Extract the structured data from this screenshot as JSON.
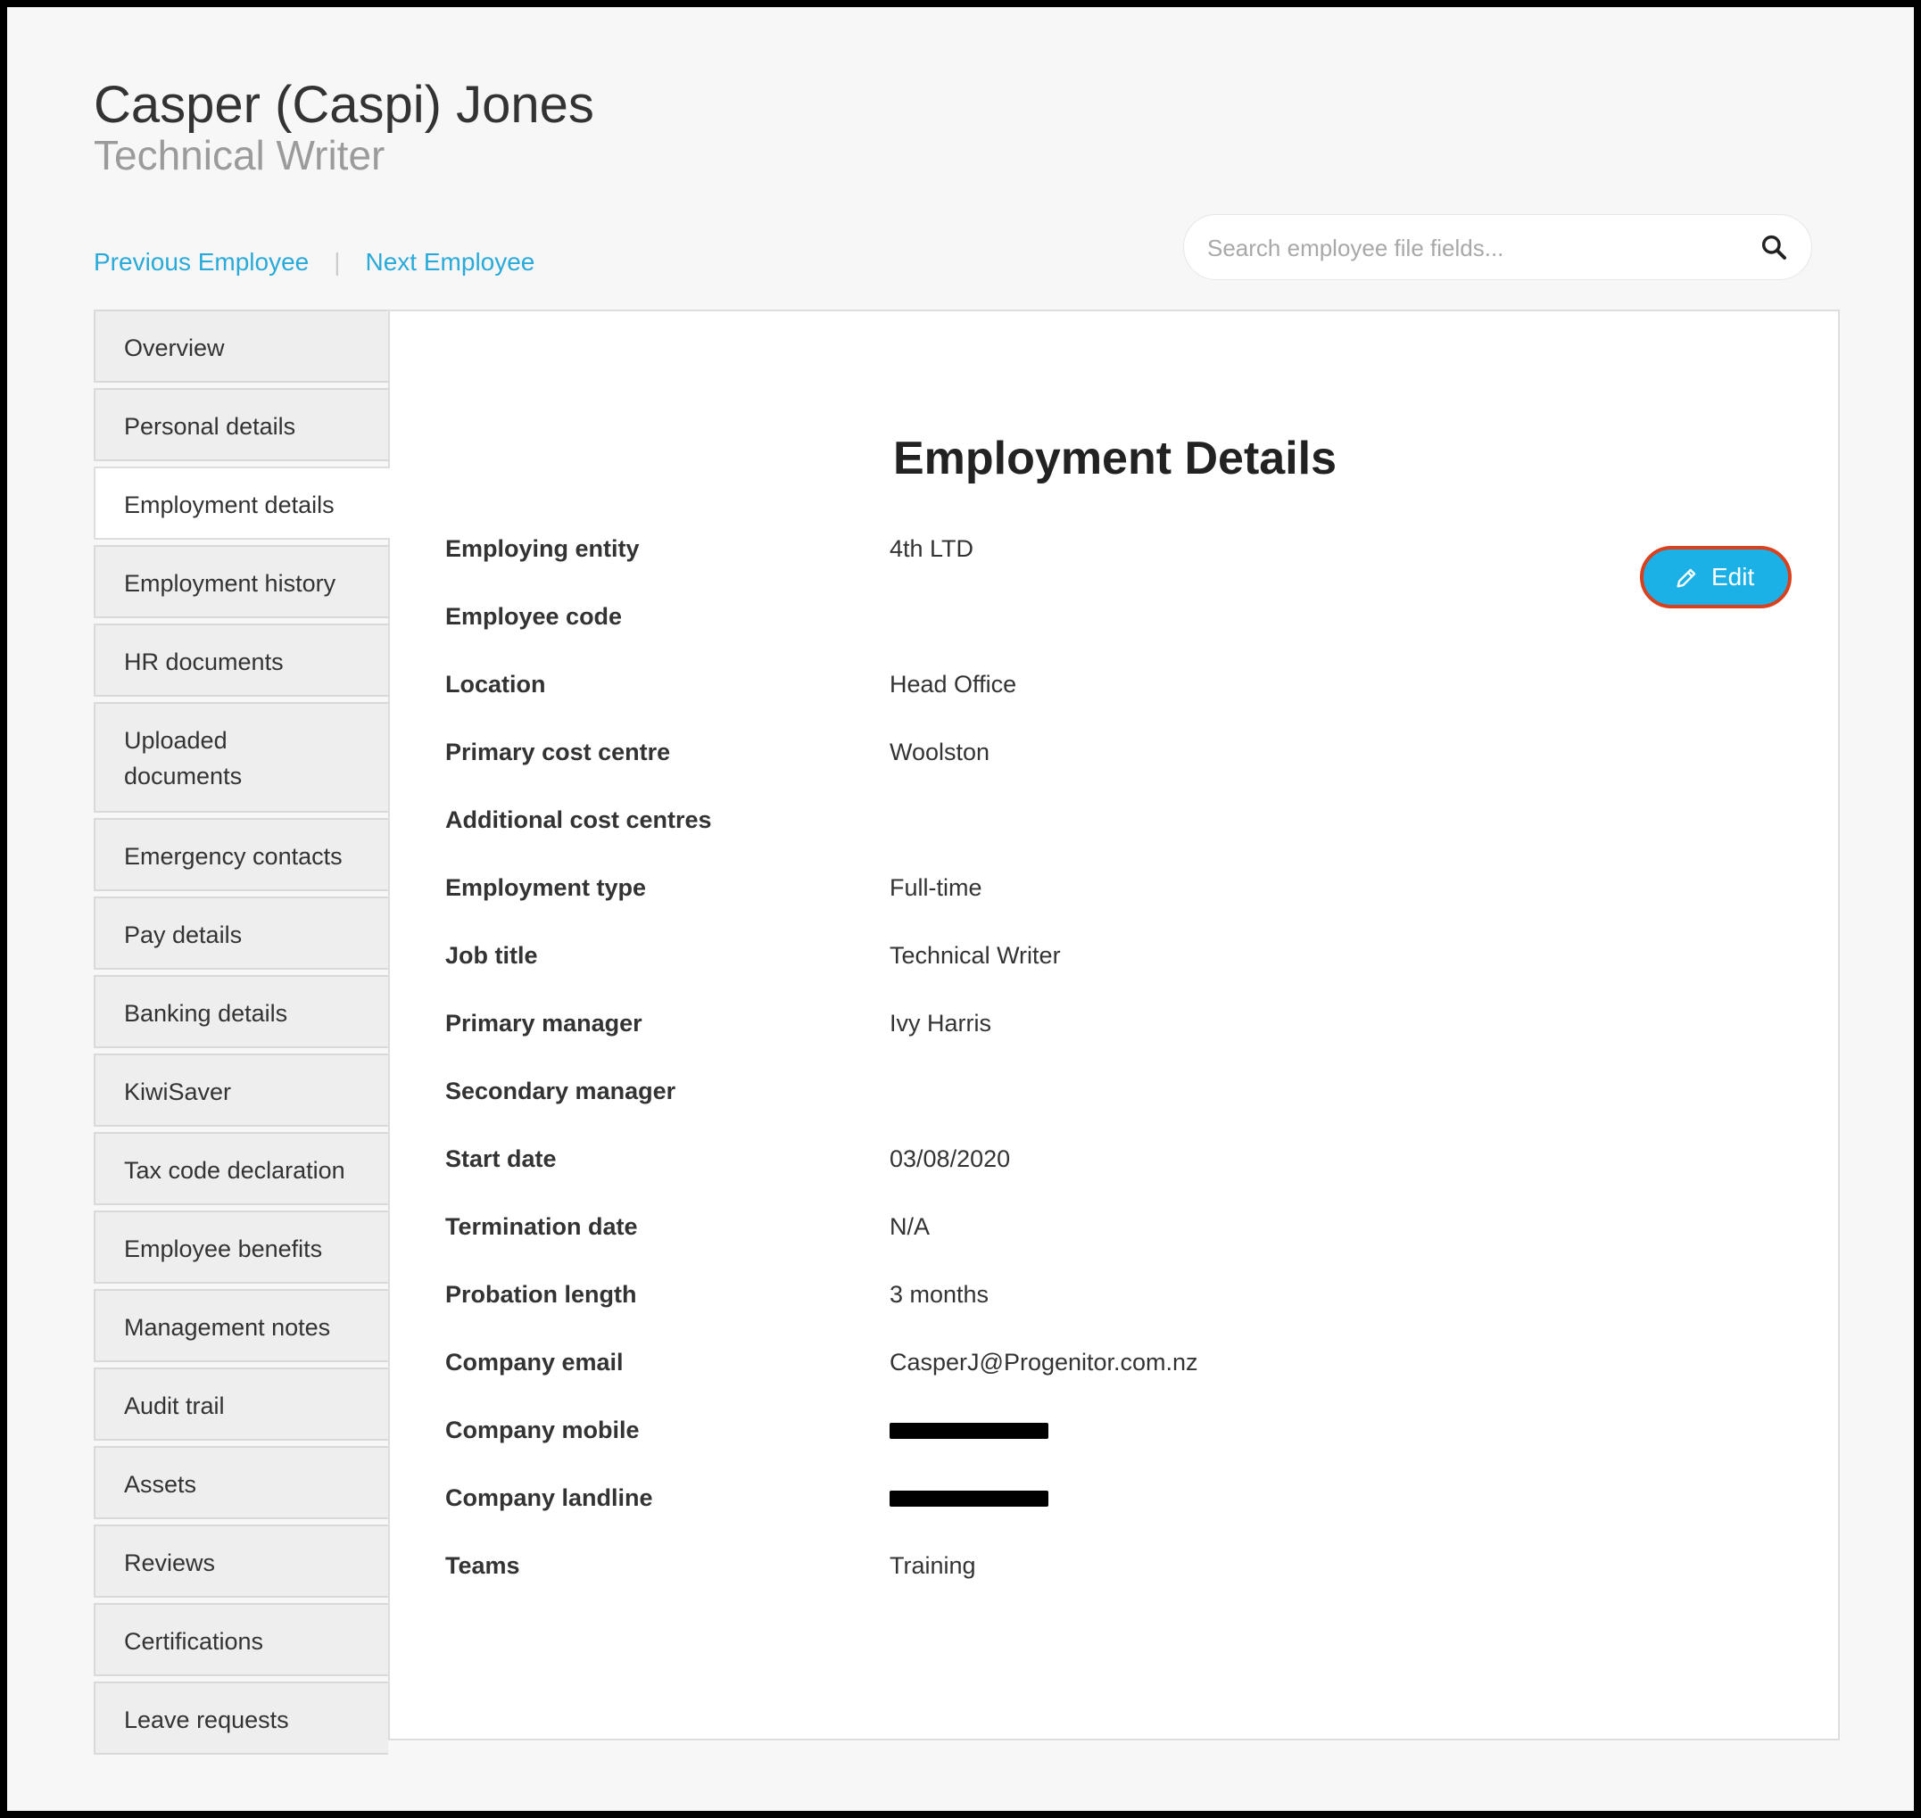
{
  "employee": {
    "name": "Casper (Caspi) Jones",
    "role": "Technical Writer"
  },
  "nav": {
    "previous": "Previous Employee",
    "separator": "|",
    "next": "Next Employee"
  },
  "search": {
    "placeholder": "Search employee file fields...",
    "value": "",
    "icon": "search-icon"
  },
  "sidebar": {
    "active": "Employment details",
    "items": [
      {
        "label": "Overview"
      },
      {
        "label": "Personal details"
      },
      {
        "label": "Employment details"
      },
      {
        "label": "Employment history"
      },
      {
        "label": "HR documents"
      },
      {
        "label": "Uploaded documents"
      },
      {
        "label": "Emergency contacts"
      },
      {
        "label": "Pay details"
      },
      {
        "label": "Banking details"
      },
      {
        "label": "KiwiSaver"
      },
      {
        "label": "Tax code declaration"
      },
      {
        "label": "Employee benefits"
      },
      {
        "label": "Management notes"
      },
      {
        "label": "Audit trail"
      },
      {
        "label": "Assets"
      },
      {
        "label": "Reviews"
      },
      {
        "label": "Certifications"
      },
      {
        "label": "Leave requests"
      }
    ]
  },
  "panel": {
    "title": "Employment Details",
    "edit_label": "Edit",
    "edit_icon": "pencil-icon",
    "fields": [
      {
        "label": "Employing entity",
        "value": "4th LTD"
      },
      {
        "label": "Employee code",
        "value": ""
      },
      {
        "label": "Location",
        "value": "Head Office"
      },
      {
        "label": "Primary cost centre",
        "value": "Woolston"
      },
      {
        "label": "Additional cost centres",
        "value": ""
      },
      {
        "label": "Employment type",
        "value": "Full-time"
      },
      {
        "label": "Job title",
        "value": "Technical Writer"
      },
      {
        "label": "Primary manager",
        "value": "Ivy Harris"
      },
      {
        "label": "Secondary manager",
        "value": ""
      },
      {
        "label": "Start date",
        "value": "03/08/2020"
      },
      {
        "label": "Termination date",
        "value": "N/A"
      },
      {
        "label": "Probation length",
        "value": "3 months"
      },
      {
        "label": "Company email",
        "value": "CasperJ@Progenitor.com.nz"
      },
      {
        "label": "Company mobile",
        "value": "",
        "redacted": true
      },
      {
        "label": "Company landline",
        "value": "",
        "redacted": true
      },
      {
        "label": "Teams",
        "value": "Training"
      }
    ]
  },
  "colors": {
    "link": "#29aad9",
    "edit_button": "#1cb1e6",
    "edit_outline": "#d9411e",
    "background": "#f7f7f7"
  }
}
